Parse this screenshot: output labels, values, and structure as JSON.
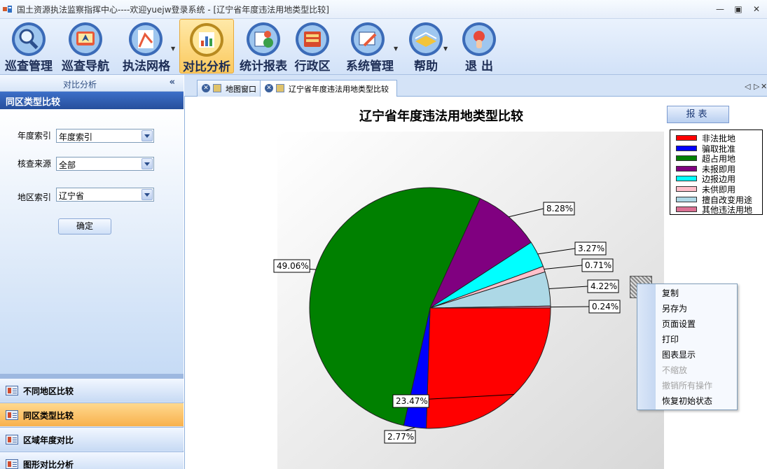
{
  "window": {
    "title": "国土资源执法监察指挥中心----欢迎yuejw登录系统 - [辽宁省年度违法用地类型比较]",
    "minimize_icon": "minimize-icon",
    "maximize_icon": "maximize-icon",
    "close_icon": "close-icon"
  },
  "toolbar": {
    "items": [
      {
        "label": "巡查管理",
        "icon": "patrol-search-icon"
      },
      {
        "label": "巡查导航",
        "icon": "navigation-icon"
      },
      {
        "label": "执法网格",
        "icon": "grid-map-icon"
      },
      {
        "label": "对比分析",
        "icon": "analysis-chart-icon"
      },
      {
        "label": "统计报表",
        "icon": "report-icon"
      },
      {
        "label": "行政区",
        "icon": "district-icon"
      },
      {
        "label": "系统管理",
        "icon": "system-settings-icon"
      },
      {
        "label": "帮助",
        "icon": "help-book-icon"
      },
      {
        "label": "退 出",
        "icon": "exit-icon"
      }
    ]
  },
  "leftpanel": {
    "header": "对比分析",
    "collapse_glyph": "«",
    "section_title": "同区类型比较",
    "form": {
      "year_label": "年度索引",
      "year_value": "年度索引",
      "source_label": "核查来源",
      "source_value": "全部",
      "region_label": "地区索引",
      "region_value": "辽宁省",
      "ok_label": "确定"
    },
    "nav": [
      {
        "label": "不同地区比较",
        "active": false
      },
      {
        "label": "同区类型比较",
        "active": true
      },
      {
        "label": "区域年度对比",
        "active": false
      },
      {
        "label": "图形对比分析",
        "active": false
      }
    ]
  },
  "tabs": [
    {
      "label": "地图窗口",
      "active": false
    },
    {
      "label": "辽宁省年度违法用地类型比较",
      "active": true
    }
  ],
  "tab_nav": {
    "prev": "◁",
    "next": "▷",
    "close": "✕"
  },
  "report_button": "报表",
  "chart_data": {
    "type": "pie",
    "title": "辽宁省年度违法用地类型比较",
    "slices": [
      {
        "name": "非法批地",
        "value": 23.47,
        "label": "23.47%",
        "color": "#ff0000"
      },
      {
        "name": "骗取批准",
        "value": 2.77,
        "label": "2.77%",
        "color": "#0000ff"
      },
      {
        "name": "超占用地",
        "value": 49.06,
        "label": "49.06%",
        "color": "#008000"
      },
      {
        "name": "未报即用",
        "value": 8.28,
        "label": "8.28%",
        "color": "#800080"
      },
      {
        "name": "边报边用",
        "value": 3.27,
        "label": "3.27%",
        "color": "#00ffff"
      },
      {
        "name": "未供即用",
        "value": 0.71,
        "label": "0.71%",
        "color": "#ffc0cb"
      },
      {
        "name": "擅自改变用途",
        "value": 4.22,
        "label": "4.22%",
        "color": "#add8e6"
      },
      {
        "name": "其他违法用地",
        "value": 0.24,
        "label": "0.24%",
        "color": "#db7093"
      }
    ],
    "legend_position": "top-right"
  },
  "context_menu": {
    "items": [
      {
        "label": "复制",
        "enabled": true
      },
      {
        "label": "另存为",
        "enabled": true
      },
      {
        "label": "页面设置",
        "enabled": true
      },
      {
        "label": "打印",
        "enabled": true
      },
      {
        "label": "图表显示",
        "enabled": true
      },
      {
        "label": "不缩放",
        "enabled": false
      },
      {
        "label": "撤销所有操作",
        "enabled": false
      },
      {
        "label": "恢复初始状态",
        "enabled": true
      }
    ]
  }
}
